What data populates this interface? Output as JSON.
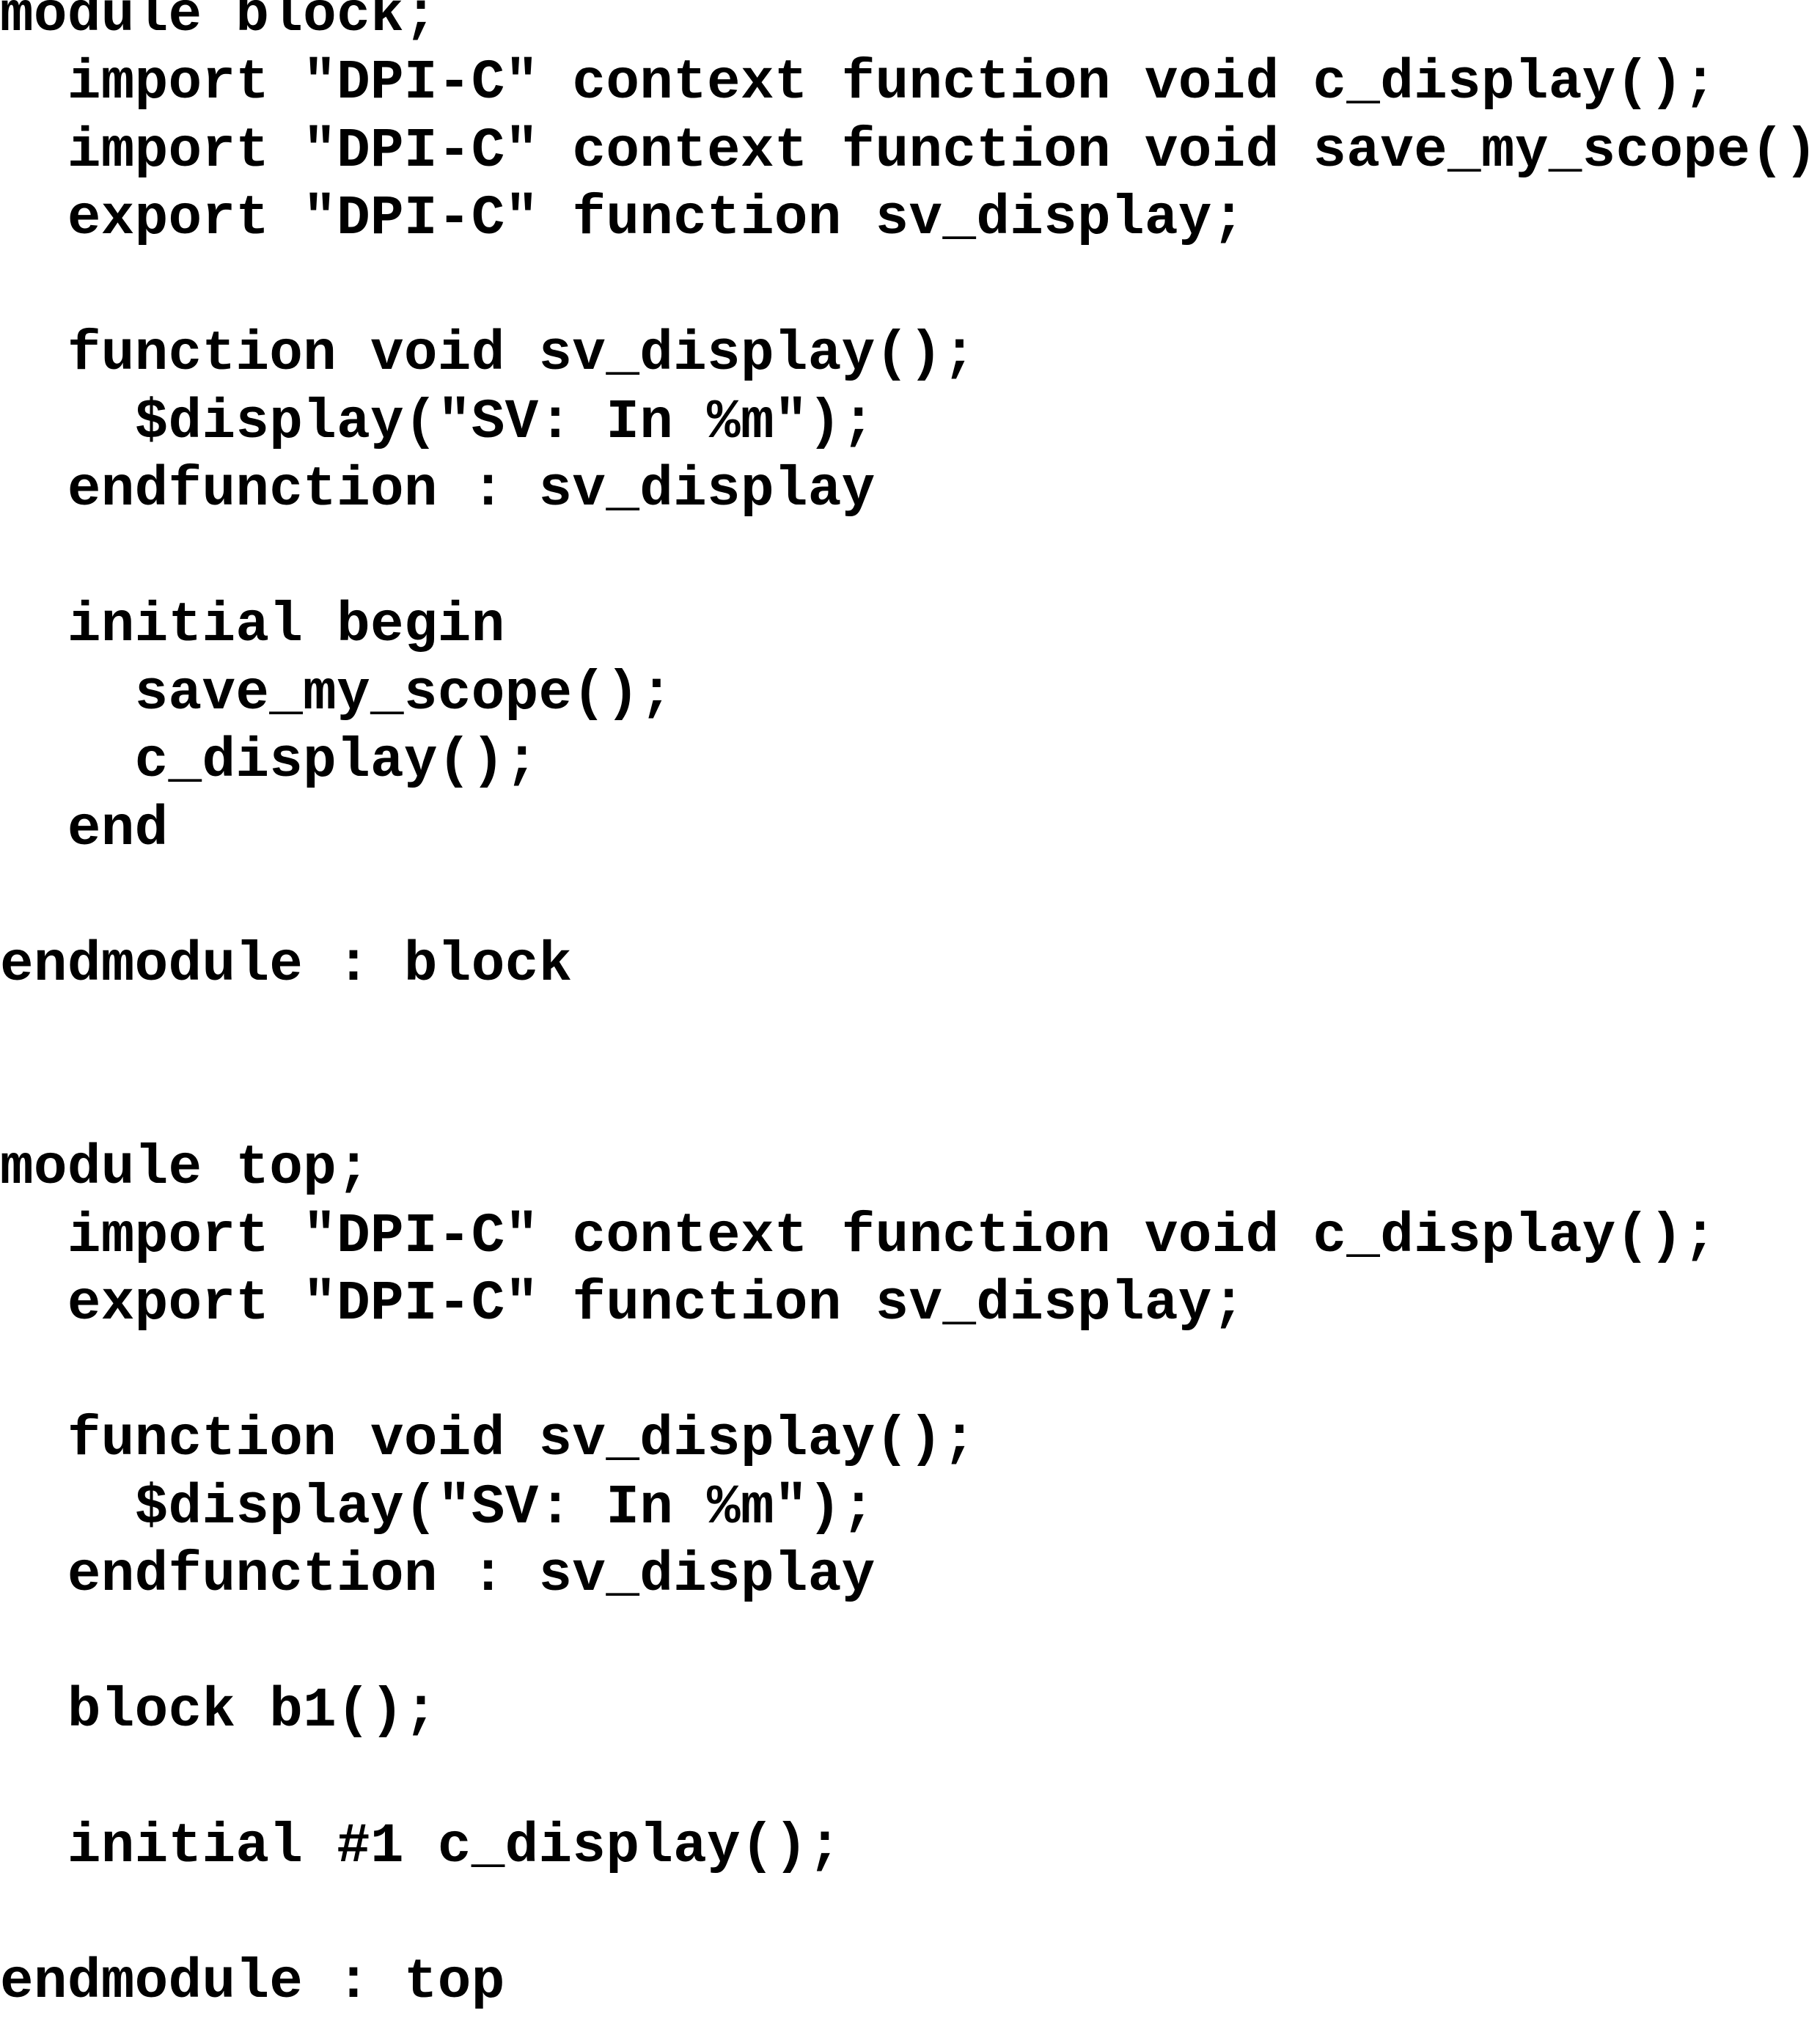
{
  "code": {
    "lines": [
      "module block;",
      "  import \"DPI-C\" context function void c_display();",
      "  import \"DPI-C\" context function void save_my_scope();",
      "  export \"DPI-C\" function sv_display;",
      "",
      "  function void sv_display();",
      "    $display(\"SV: In %m\");",
      "  endfunction : sv_display",
      "",
      "  initial begin",
      "    save_my_scope();",
      "    c_display();",
      "  end",
      "",
      "endmodule : block",
      "",
      "",
      "module top;",
      "  import \"DPI-C\" context function void c_display();",
      "  export \"DPI-C\" function sv_display;",
      "",
      "  function void sv_display();",
      "    $display(\"SV: In %m\");",
      "  endfunction : sv_display",
      "",
      "  block b1();",
      "",
      "  initial #1 c_display();",
      "",
      "endmodule : top"
    ]
  }
}
